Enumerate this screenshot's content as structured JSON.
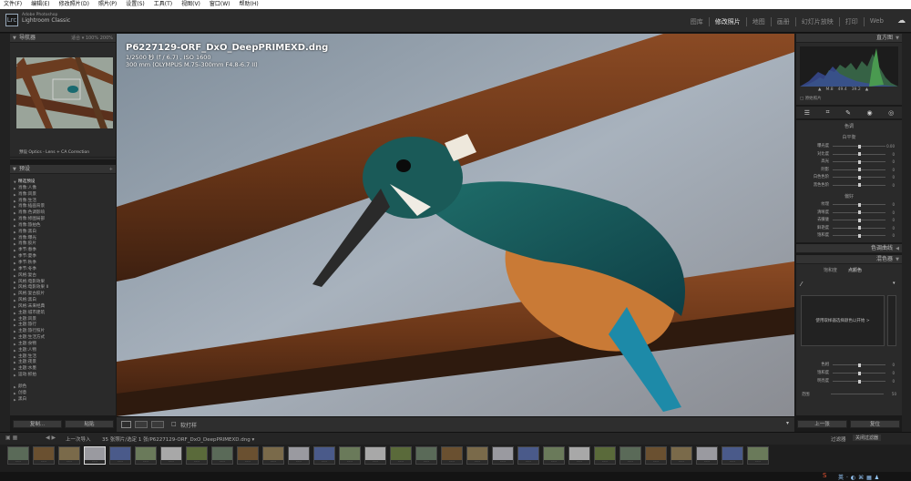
{
  "menu": [
    "文件(F)",
    "编辑(E)",
    "修改照片(D)",
    "照片(P)",
    "设置(S)",
    "工具(T)",
    "视图(V)",
    "窗口(W)",
    "帮助(H)"
  ],
  "identity": {
    "line1": "Adobe Photoshop",
    "line2": "Lightroom Classic",
    "logo": "Lrc"
  },
  "modules": [
    "图库",
    "修改照片",
    "地图",
    "画册",
    "幻灯片放映",
    "打印",
    "Web"
  ],
  "active_module": "修改照片",
  "navigator": {
    "title": "导航器",
    "zoom": [
      "适合 ▾",
      "100%",
      "200%"
    ]
  },
  "profile_bar": "预设 Optics - Lens + CA Correction",
  "presets": {
    "title": "预设",
    "items": [
      "精选预设",
      "肖像:人像",
      "肖像:风景",
      "肖像:生活",
      "肖像:插画背景",
      "肖像:色调影响",
      "肖像:修图局部",
      "肖像:旅拍色",
      "肖像:黑白",
      "肖像:曝光",
      "肖像:胶片",
      "季节:春季",
      "季节:夏季",
      "季节:秋季",
      "季节:冬季",
      "风格:复古",
      "风格:电影效果",
      "风格:电影效果 II",
      "风格:复古胶片",
      "风格:黑白",
      "风格:未来经典",
      "主题:城市建筑",
      "主题:风景",
      "主题:旅行",
      "主题:旅行照片",
      "主题:生活方式",
      "主题:食物",
      "主题:人物",
      "主题:生活",
      "主题:夜景",
      "主题:水墨",
      "运动:抓拍"
    ],
    "bottom_items": [
      "颜色",
      "创意",
      "黑白"
    ]
  },
  "left_buttons": {
    "copy": "复制...",
    "paste": "粘贴"
  },
  "photo": {
    "filename": "P6227129-ORF_DxO_DeepPRIMEXD.dng",
    "exposure": "1/2500 秒 (f / 6.7) ,  ISO 1600",
    "lens": "300 mm (OLYMPUS M.75-300mm F4.8-6.7 II)"
  },
  "toolbar": {
    "soft_proof_label": "软打样",
    "checkbox": "□"
  },
  "filmstrip_bar": {
    "nav": "上一次导入",
    "count": "35 张照片/选定 1 张/P6227129-ORF_DxO_DeepPRIMEXD.dng ▾",
    "filter_label": "过滤器",
    "filter_value": "关闭过滤器"
  },
  "histogram": {
    "title": "直方图",
    "readout": [
      "▲",
      "M.8",
      "49.4",
      "39.2",
      "▲"
    ],
    "checkbox": "原始照片"
  },
  "basic": {
    "treatment": "色调",
    "wb_label": "白平衡",
    "sliders": [
      {
        "label": "曝光度",
        "value": "0.00"
      },
      {
        "label": "对比度",
        "value": "0"
      },
      {
        "label": "高光",
        "value": "0"
      },
      {
        "label": "阴影",
        "value": "0"
      },
      {
        "label": "白色色阶",
        "value": "0"
      },
      {
        "label": "黑色色阶",
        "value": "0"
      }
    ],
    "presence": "偏好",
    "presence_sliders": [
      {
        "label": "纹理",
        "value": "0"
      },
      {
        "label": "清晰度",
        "value": "0"
      },
      {
        "label": "去朦胧",
        "value": "0"
      },
      {
        "label": "鲜艳度",
        "value": "0"
      },
      {
        "label": "饱和度",
        "value": "0"
      }
    ]
  },
  "tone_curve": "色调曲线",
  "color_mixer": {
    "title": "混色器",
    "tab1": "饱和度",
    "tab2": "点颜色",
    "message": "使用取样器选择颜色以开始 >"
  },
  "adjust": {
    "sliders": [
      {
        "label": "色相",
        "value": "0"
      },
      {
        "label": "饱和度",
        "value": "0"
      },
      {
        "label": "明亮度",
        "value": "0"
      }
    ],
    "range": "范围",
    "range_value": "50"
  },
  "right_buttons": {
    "previous": "上一张",
    "reset": "复位"
  },
  "filmstrip_count": 30,
  "colors": {
    "accent": "#8aaed8",
    "bg": "#2a2a2a",
    "panel_header": "#333333"
  }
}
